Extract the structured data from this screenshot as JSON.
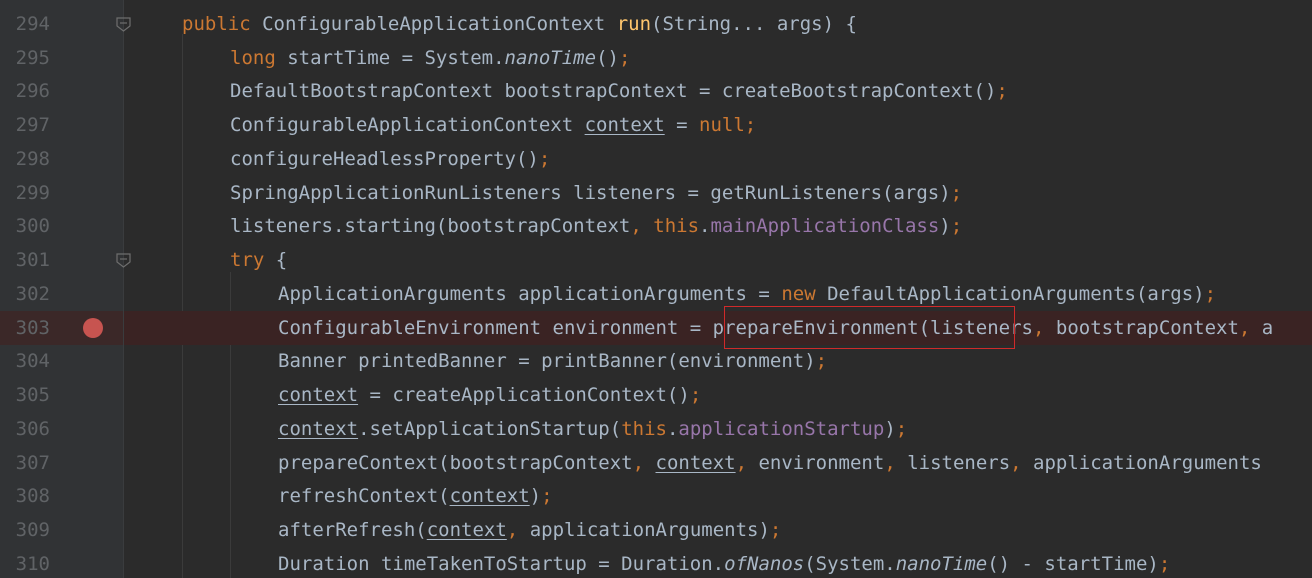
{
  "editor": {
    "line_numbers": [
      "294",
      "295",
      "296",
      "297",
      "298",
      "299",
      "300",
      "301",
      "302",
      "303",
      "304",
      "305",
      "306",
      "307",
      "308",
      "309",
      "310"
    ],
    "breakpoint_line": "303",
    "code": {
      "l294": {
        "a": "public ",
        "b": "ConfigurableApplicationContext ",
        "c": "run",
        "d": "(String... args) {"
      },
      "l295": {
        "a": "long ",
        "b": "startTime = System.",
        "c": "nanoTime",
        "d": "()",
        "e": ";"
      },
      "l296": {
        "a": "DefaultBootstrapContext bootstrapContext = createBootstrapContext()",
        "b": ";"
      },
      "l297": {
        "a": "ConfigurableApplicationContext ",
        "b": "context",
        "c": " = ",
        "d": "null",
        "e": ";"
      },
      "l298": {
        "a": "configureHeadlessProperty()",
        "b": ";"
      },
      "l299": {
        "a": "SpringApplicationRunListeners listeners = getRunListeners(args)",
        "b": ";"
      },
      "l300": {
        "a": "listeners.starting(bootstrapContext",
        "b": ", ",
        "c": "this",
        "d": ".",
        "e": "mainApplicationClass",
        "f": ")",
        "g": ";"
      },
      "l301": {
        "a": "try ",
        "b": "{"
      },
      "l302": {
        "a": "ApplicationArguments applicationArguments = ",
        "b": "new ",
        "c": "DefaultApplicationArguments(args)",
        "d": ";"
      },
      "l303": {
        "a": "ConfigurableEnvironment environment = prepareEnvironment(listeners",
        "b": ", ",
        "c": "bootstrapContext",
        "d": ", ",
        "e": "a"
      },
      "l304": {
        "a": "Banner printedBanner = printBanner(environment)",
        "b": ";"
      },
      "l305": {
        "a": "context",
        "b": " = createApplicationContext()",
        "c": ";"
      },
      "l306": {
        "a": "context",
        "b": ".setApplicationStartup(",
        "c": "this",
        "d": ".",
        "e": "applicationStartup",
        "f": ")",
        "g": ";"
      },
      "l307": {
        "a": "prepareContext(bootstrapContext",
        "b": ", ",
        "c": "context",
        "d": ", ",
        "e": "environment",
        "f": ", ",
        "g": "listeners",
        "h": ", ",
        "i": "applicationArguments"
      },
      "l308": {
        "a": "refreshContext(",
        "b": "context",
        "c": ")",
        "d": ";"
      },
      "l309": {
        "a": "afterRefresh(",
        "b": "context",
        "c": ", ",
        "d": "applicationArguments)",
        "e": ";"
      },
      "l310": {
        "a": "Duration timeTakenToStartup = Duration.",
        "b": "ofNanos",
        "c": "(System.",
        "d": "nanoTime",
        "e": "() - startTime)",
        "f": ";"
      }
    }
  }
}
